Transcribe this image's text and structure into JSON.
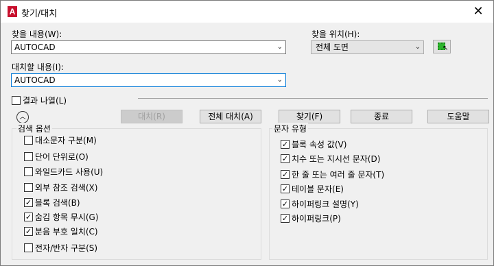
{
  "window": {
    "title": "찾기/대치",
    "app_icon_letter": "A"
  },
  "find": {
    "label": "찾을 내용(W):",
    "value": "AUTOCAD"
  },
  "replace": {
    "label": "대치할 내용(I):",
    "value": "AUTOCAD"
  },
  "find_where": {
    "label": "찾을 위치(H):",
    "value": "전체 도면"
  },
  "list_results": {
    "label": "결과 나열(L)",
    "checked": false
  },
  "buttons": {
    "replace": "대치(R)",
    "replace_all": "전체 대치(A)",
    "find": "찾기(F)",
    "done": "종료",
    "help": "도움말"
  },
  "search_options": {
    "title": "검색 옵션",
    "items": [
      {
        "label": "대소문자 구분(M)",
        "checked": false
      },
      {
        "label": "단어 단위로(O)",
        "checked": false
      },
      {
        "label": "와일드카드 사용(U)",
        "checked": false
      },
      {
        "label": "외부 참조 검색(X)",
        "checked": false
      },
      {
        "label": "블록 검색(B)",
        "checked": true
      },
      {
        "label": "숨김 항목 무시(G)",
        "checked": true
      },
      {
        "label": "분음 부호 일치(C)",
        "checked": true
      },
      {
        "label": "전자/반자 구분(S)",
        "checked": false
      }
    ]
  },
  "text_types": {
    "title": "문자 유형",
    "items": [
      {
        "label": "블록 속성 값(V)",
        "checked": true
      },
      {
        "label": "치수 또는 지시선 문자(D)",
        "checked": true
      },
      {
        "label": "한 줄 또는 여러 줄 문자(T)",
        "checked": true
      },
      {
        "label": "테이블 문자(E)",
        "checked": true
      },
      {
        "label": "하이퍼링크 설명(Y)",
        "checked": true
      },
      {
        "label": "하이퍼링크(P)",
        "checked": true
      }
    ]
  },
  "icons": {
    "close": "close-icon",
    "dropdown": "chevron-down-icon",
    "pick": "select-objects-icon",
    "collapse": "chevron-up-icon"
  }
}
